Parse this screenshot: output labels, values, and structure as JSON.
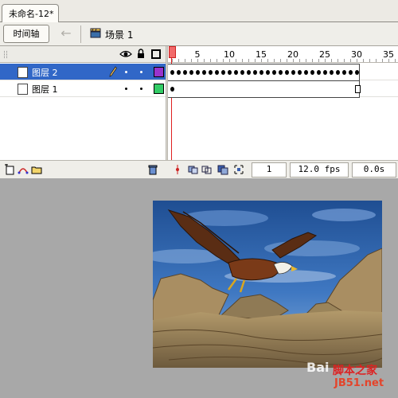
{
  "document_tab": {
    "label": "未命名-12*"
  },
  "toolbar": {
    "timeline_button": "时间轴",
    "scene_label": "场景 1"
  },
  "timeline": {
    "ruler_labels": [
      "1",
      "5",
      "10",
      "15",
      "20",
      "25",
      "30",
      "35"
    ],
    "layers": [
      {
        "name": "图层 2",
        "selected": true,
        "color": "#9933cc",
        "icon": "pencil-icon"
      },
      {
        "name": "图层 1",
        "selected": false,
        "color": "#33cc66",
        "icon": ""
      }
    ],
    "current_frame": "1",
    "frame_rate": "12.0 fps",
    "elapsed_time": "0.0s"
  },
  "watermark": {
    "baidu": "Bai",
    "site_cn": "脚本之家",
    "site_url": "JB51.net"
  },
  "colors": {
    "selection": "#3167c7",
    "playhead": "#e02020",
    "stage_bg": "#a8a8a8"
  }
}
